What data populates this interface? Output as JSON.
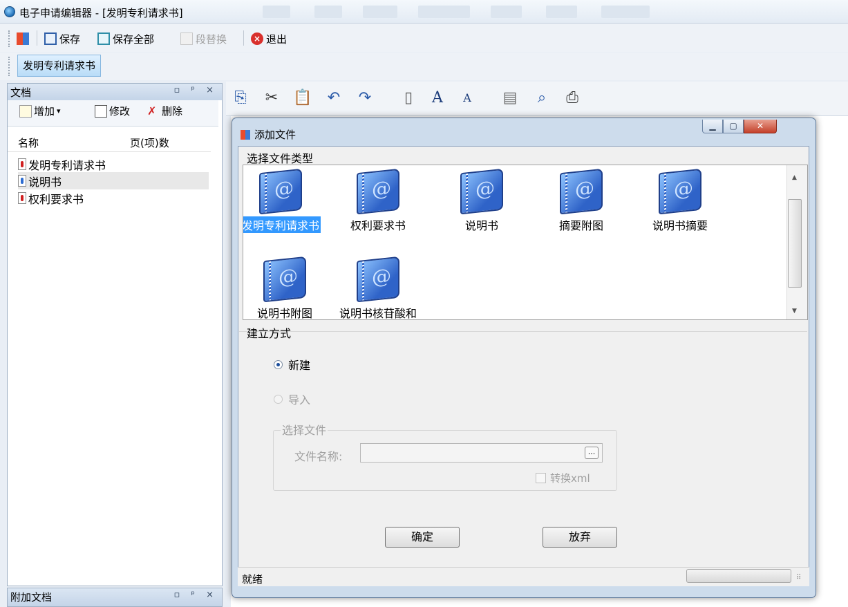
{
  "window": {
    "title": "电子申请编辑器 - [发明专利请求书]"
  },
  "toolbar": {
    "save_label": "保存",
    "save_all_label": "保存全部",
    "replace_label": "段替换",
    "exit_label": "退出"
  },
  "doc_tab": {
    "label": "发明专利请求书"
  },
  "left_panel": {
    "title": "文档",
    "controls": "▫ ᵖ ×",
    "add_label": "增加",
    "edit_label": "修改",
    "delete_label": "删除",
    "col_name": "名称",
    "col_pages": "页(项)数",
    "items": [
      {
        "label": "发明专利请求书",
        "icon": "red-doc-icon"
      },
      {
        "label": "说明书",
        "icon": "blue-doc-icon"
      },
      {
        "label": "权利要求书",
        "icon": "red-doc-icon"
      }
    ]
  },
  "attach_panel": {
    "title": "附加文档",
    "controls": "▫ ᵖ ×"
  },
  "dialog": {
    "title": "添加文件",
    "group_type": "选择文件类型",
    "file_types": [
      "发明专利请求书",
      "权利要求书",
      "说明书",
      "摘要附图",
      "说明书摘要",
      "说明书附图",
      "说明书核苷酸和"
    ],
    "group_mode": "建立方式",
    "option_new": "新建",
    "option_import": "导入",
    "group_select": "选择文件",
    "file_name_label": "文件名称:",
    "browse_label": "...",
    "convert_label": "转换xml",
    "ok_label": "确定",
    "cancel_label": "放弃",
    "status": "就绪"
  },
  "colors": {
    "selection": "#3399ff",
    "title_bg": "#e3ebf4",
    "dialog_frame": "#cddcec"
  }
}
